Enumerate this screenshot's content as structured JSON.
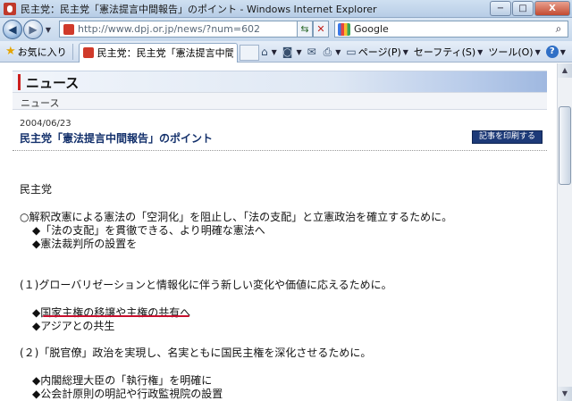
{
  "window": {
    "title": "民主党：民主党「憲法提言中間報告」のポイント - Windows Internet Explorer",
    "controls": {
      "minimize": "−",
      "maximize": "□",
      "close": "X"
    }
  },
  "addressbar": {
    "url": "http://www.dpj.or.jp/news/?num=602",
    "search_provider": "Google"
  },
  "commandbar": {
    "favorites_label": "お気に入り",
    "tab_title": "民主党：民主党「憲法提言中間報告...",
    "page_label": "ページ(P)",
    "safety_label": "セーフティ(S)",
    "tools_label": "ツール(O)"
  },
  "page": {
    "section_title": "ニュース",
    "section_sub": "ニュース",
    "date": "2004/06/23",
    "article_title": "民主党「憲法提言中間報告」のポイント",
    "print_button": "記事を印刷する",
    "lines": {
      "author": "民主党",
      "intro": "○解釈改憲による憲法の「空洞化」を阻止し、「法の支配」と立憲政治を確立するために。",
      "intro_b1": "◆「法の支配」を貫徹できる、より明確な憲法へ",
      "intro_b2": "◆憲法裁判所の設置を",
      "s1": "(１)グローバリゼーションと情報化に伴う新しい変化や価値に応えるために。",
      "s1_b1": "◆国家主権の移譲や主権の共有へ",
      "s1_b2": "◆アジアとの共生",
      "s2": "(２)「脱官僚」政治を実現し、名実ともに国民主権を深化させるために。",
      "s2_b1": "◆内閣総理大臣の「執行権」を明確に",
      "s2_b2": "◆公会計原則の明記や行政監視院の設置"
    }
  }
}
